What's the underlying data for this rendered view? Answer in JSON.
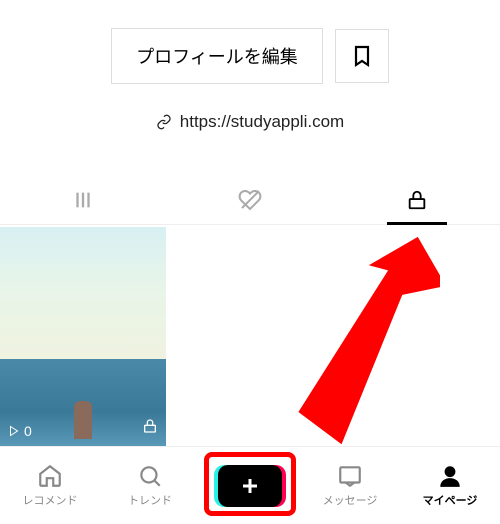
{
  "profile": {
    "edit_button": "プロフィールを編集",
    "link_url": "https://studyappli.com"
  },
  "video": {
    "play_count": "0"
  },
  "nav": {
    "home": "レコメンド",
    "trend": "トレンド",
    "message": "メッセージ",
    "mypage": "マイページ"
  }
}
